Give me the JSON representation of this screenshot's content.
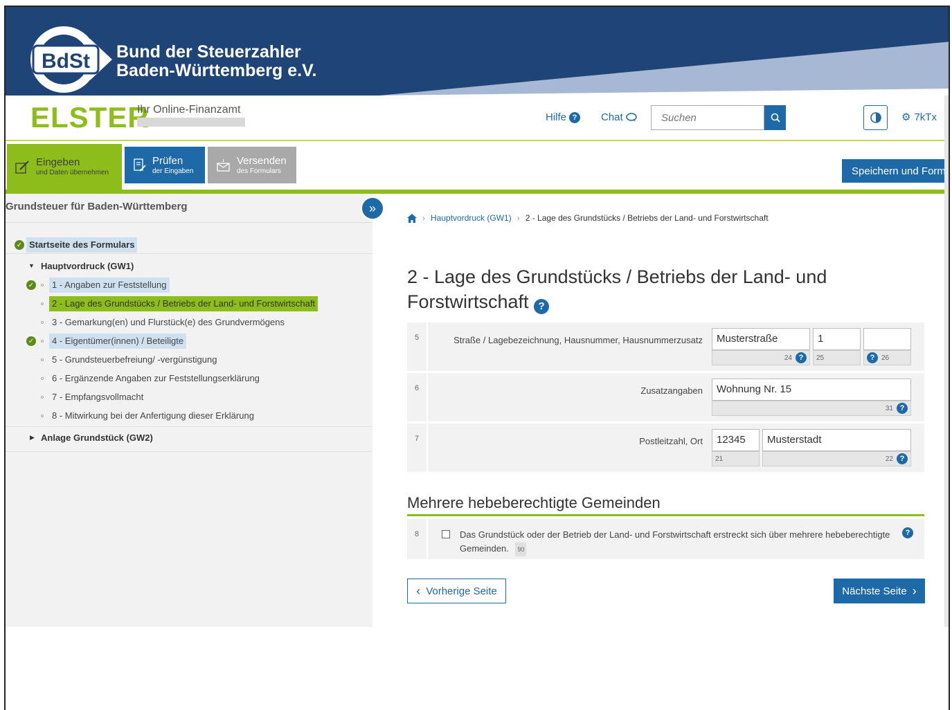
{
  "banner": {
    "logo_text": "BdSt",
    "title_line1": "Bund der Steuerzahler",
    "title_line2": "Baden-Württemberg e.V."
  },
  "header": {
    "logo": "ELSTER",
    "subtitle": "Ihr Online-Finanzamt",
    "help_label": "Hilfe",
    "chat_label": "Chat",
    "search_placeholder": "Suchen",
    "user_id": "7kTx"
  },
  "workflow": {
    "tabs": [
      {
        "label": "Eingeben",
        "sub": "und Daten übernehmen",
        "icon": "edit-icon"
      },
      {
        "label": "Prüfen",
        "sub": "der Eingaben",
        "icon": "check-document-icon"
      },
      {
        "label": "Versenden",
        "sub": "des Formulars",
        "icon": "envelope-icon"
      }
    ],
    "save_label": "Speichern und Formular schließen"
  },
  "sidebar": {
    "title": "Grundsteuer für Baden-Württemberg",
    "start": "Startseite des Formulars",
    "group1": "Hauptvordruck (GW1)",
    "items": [
      {
        "label": "1 - Angaben zur Feststellung",
        "done": true
      },
      {
        "label": "2 - Lage des Grundstücks / Betriebs der Land- und Forstwirtschaft",
        "active": true
      },
      {
        "label": "3 - Gemarkung(en) und Flurstück(e) des Grundvermögens"
      },
      {
        "label": "4 - Eigentümer(innen) / Beteiligte",
        "done": true
      },
      {
        "label": "5 - Grundsteuerbefreiung/ -vergünstigung"
      },
      {
        "label": "6 - Ergänzende Angaben zur Feststellungserklärung"
      },
      {
        "label": "7 - Empfangsvollmacht"
      },
      {
        "label": "8 - Mitwirkung bei der Anfertigung dieser Erklärung"
      }
    ],
    "group2": "Anlage Grundstück (GW2)"
  },
  "breadcrumb": {
    "level1": "Hauptvordruck (GW1)",
    "level2": "2 - Lage des Grundstücks / Betriebs der Land- und Forstwirtschaft"
  },
  "page": {
    "title": "2 - Lage des Grundstücks / Betriebs der Land- und Forstwirtschaft",
    "help": "?"
  },
  "form": {
    "row5": {
      "num": "5",
      "label": "Straße / Lagebezeichnung,  Hausnummer,  Hausnummerzusatz",
      "street": "Musterstraße",
      "street_code": "24",
      "number": "1",
      "number_code": "25",
      "suffix": "",
      "suffix_code": "26"
    },
    "row6": {
      "num": "6",
      "label": "Zusatzangaben",
      "value": "Wohnung  Nr. 15",
      "code": "31"
    },
    "row7": {
      "num": "7",
      "label": "Postleitzahl,  Ort",
      "zip": "12345",
      "zip_code": "21",
      "city": "Musterstadt",
      "city_code": "22"
    }
  },
  "section2": {
    "heading": "Mehrere hebeberechtigte Gemeinden",
    "row8": {
      "num": "8",
      "text": "Das Grundstück oder der Betrieb der Land- und Forstwirtschaft erstreckt sich über mehrere hebeberechtigte Gemeinden.",
      "code": "90",
      "checked": false
    }
  },
  "nav": {
    "prev": "Vorherige Seite",
    "next": "Nächste Seite"
  },
  "colors": {
    "primary_blue": "#1e6aa8",
    "elster_green": "#8dbd1a",
    "banner_blue": "#1f4477"
  }
}
